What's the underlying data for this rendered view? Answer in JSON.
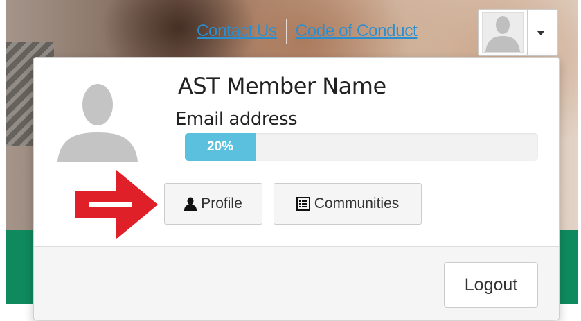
{
  "header": {
    "links": [
      {
        "label": "Contact Us"
      },
      {
        "label": "Code of Conduct"
      }
    ],
    "user_menu_icon": "user-avatar-placeholder-icon",
    "caret_icon": "caret-down-icon"
  },
  "dropdown": {
    "member_name": "AST Member Name",
    "email": "Email address",
    "profile_completion": {
      "value_percent": 20,
      "label": "20%"
    },
    "buttons": {
      "profile": {
        "label": "Profile",
        "icon": "user-icon"
      },
      "communities": {
        "label": "Communities",
        "icon": "list-icon"
      }
    },
    "logout_label": "Logout"
  },
  "annotation": {
    "arrow_icon": "red-arrow-icon",
    "arrow_color": "#e02028"
  },
  "colors": {
    "link": "#2a8fd0",
    "progress": "#5bc0de",
    "green_band": "#0f8a5f"
  }
}
